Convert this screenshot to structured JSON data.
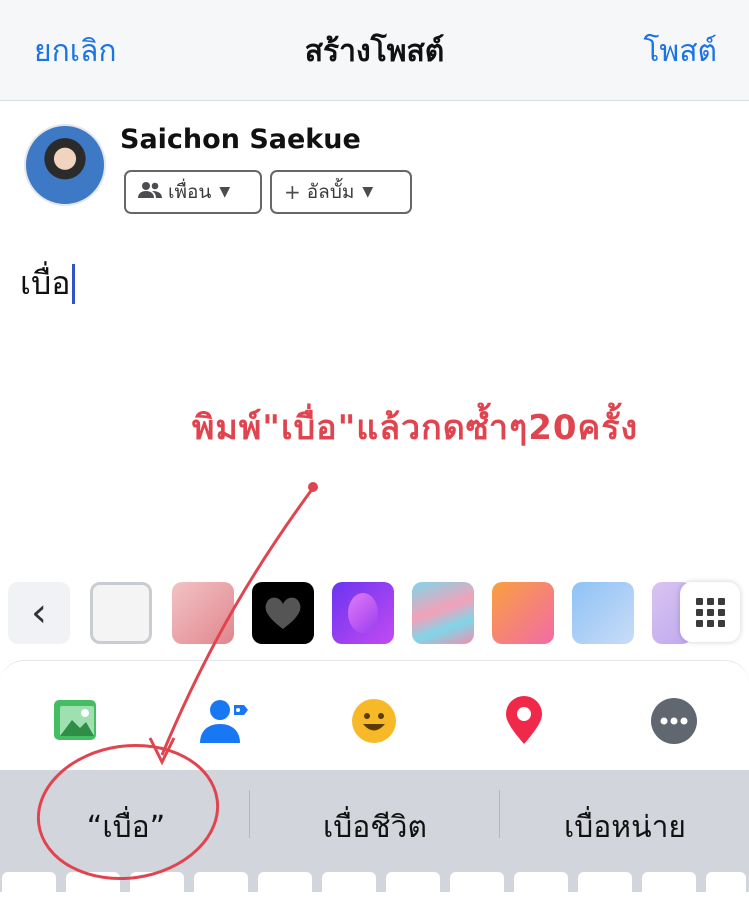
{
  "header": {
    "cancel_label": "ยกเลิก",
    "title": "สร้างโพสต์",
    "post_label": "โพสต์"
  },
  "composer": {
    "user_name": "Saichon Saekue",
    "audience_label": "เพื่อน",
    "album_label": "อัลบั้ม",
    "post_text": "เบื่อ"
  },
  "annotation": {
    "text": "พิมพ์\"เบื่อ\"แล้วกดซ้ำๆ20ครั้ง",
    "color": "#e0454f"
  },
  "background_picker": {
    "icons": [
      "chevron-left-icon",
      "grid-icon"
    ],
    "swatches": [
      "plain-white",
      "pink-gradient",
      "black-heart",
      "purple-balloon",
      "blue-pink-wave",
      "orange-pink-gradient",
      "blue-gradient",
      "lavender-gradient"
    ]
  },
  "toolbar": {
    "icons": [
      "photo-icon",
      "tag-people-icon",
      "feeling-icon",
      "location-icon",
      "more-icon"
    ]
  },
  "keyboard": {
    "suggestions": [
      "“เบื่อ”",
      "เบื่อชีวิต",
      "เบื่อหน่าย"
    ]
  },
  "colors": {
    "accent": "#1b74e4",
    "annotation": "#e0454f",
    "keyboard_bg": "#d2d5db"
  }
}
